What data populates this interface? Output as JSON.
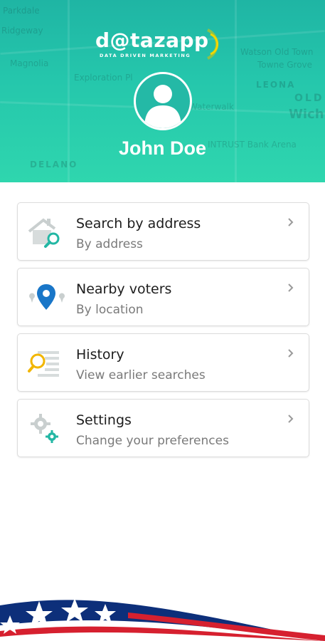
{
  "header": {
    "logo_text": "d@tazapp",
    "logo_tagline": "DATA DRIVEN MARKETING",
    "user_name": "John Doe",
    "colors": {
      "gradient_top": "#1fb5a4",
      "gradient_bottom": "#2fd6ae",
      "logo_ring_green": "#8bc34a",
      "logo_ring_yellow": "#f2d600"
    },
    "map_labels": [
      "Parkdale",
      "Ridgeway",
      "Magnolia",
      "Exploration Pl",
      "Waterwalk",
      "DELANO",
      "Watson Old Town",
      "Towne Grove",
      "LEONA",
      "OLD",
      "Wich",
      "INTRUST Bank Arena"
    ]
  },
  "menu": {
    "items": [
      {
        "title": "Search by address",
        "subtitle": "By address",
        "icon": "house-search-icon"
      },
      {
        "title": "Nearby voters",
        "subtitle": "By location",
        "icon": "location-pin-icon"
      },
      {
        "title": "History",
        "subtitle": "View earlier searches",
        "icon": "history-search-icon"
      },
      {
        "title": "Settings",
        "subtitle": "Change your preferences",
        "icon": "gears-icon"
      }
    ]
  },
  "footer": {
    "decoration": "american-flag-wave"
  }
}
